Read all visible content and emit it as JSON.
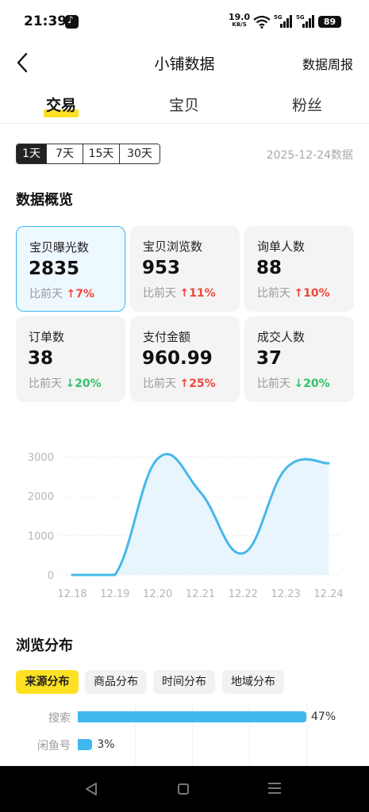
{
  "status_bar": {
    "time": "21:39",
    "net_speed": "19.0",
    "net_unit": "KB/S",
    "signal1": "5G",
    "signal2": "5G",
    "battery": "89"
  },
  "header": {
    "title": "小铺数据",
    "right_link": "数据周报"
  },
  "main_tabs": [
    {
      "label": "交易"
    },
    {
      "label": "宝贝"
    },
    {
      "label": "粉丝"
    }
  ],
  "periods": [
    {
      "label": "1天"
    },
    {
      "label": "7天"
    },
    {
      "label": "15天"
    },
    {
      "label": "30天"
    }
  ],
  "data_date": "2025-12-24数据",
  "overview": {
    "title": "数据概览",
    "compare_label": "比前天",
    "cards": [
      {
        "label": "宝贝曝光数",
        "value": "2835",
        "change": "7%",
        "direction": "up"
      },
      {
        "label": "宝贝浏览数",
        "value": "953",
        "change": "11%",
        "direction": "up"
      },
      {
        "label": "询单人数",
        "value": "88",
        "change": "10%",
        "direction": "up"
      },
      {
        "label": "订单数",
        "value": "38",
        "change": "20%",
        "direction": "down"
      },
      {
        "label": "支付金额",
        "value": "960.99",
        "change": "25%",
        "direction": "up"
      },
      {
        "label": "成交人数",
        "value": "37",
        "change": "20%",
        "direction": "down"
      }
    ]
  },
  "chart_data": {
    "type": "area",
    "x": [
      "12.18",
      "12.19",
      "12.20",
      "12.21",
      "12.22",
      "12.23",
      "12.24"
    ],
    "values": [
      0,
      0,
      2950,
      2100,
      550,
      2700,
      2835
    ],
    "yticks": [
      0,
      1000,
      2000,
      3000
    ],
    "ylim": [
      0,
      3000
    ],
    "grid": true,
    "colors": {
      "line": "#45b8ea",
      "fill": "#e8f5fd"
    }
  },
  "distribution": {
    "title": "浏览分布",
    "tabs": [
      {
        "label": "来源分布"
      },
      {
        "label": "商品分布"
      },
      {
        "label": "时间分布"
      },
      {
        "label": "地域分布"
      }
    ],
    "bars": [
      {
        "label": "搜索",
        "value": 47,
        "display": "47%"
      },
      {
        "label": "闲鱼号",
        "value": 3,
        "display": "3%"
      }
    ]
  },
  "colors": {
    "accent_yellow": "#ffe124",
    "up": "#f0473c",
    "down": "#32c16a",
    "blue": "#3fb7ef"
  }
}
